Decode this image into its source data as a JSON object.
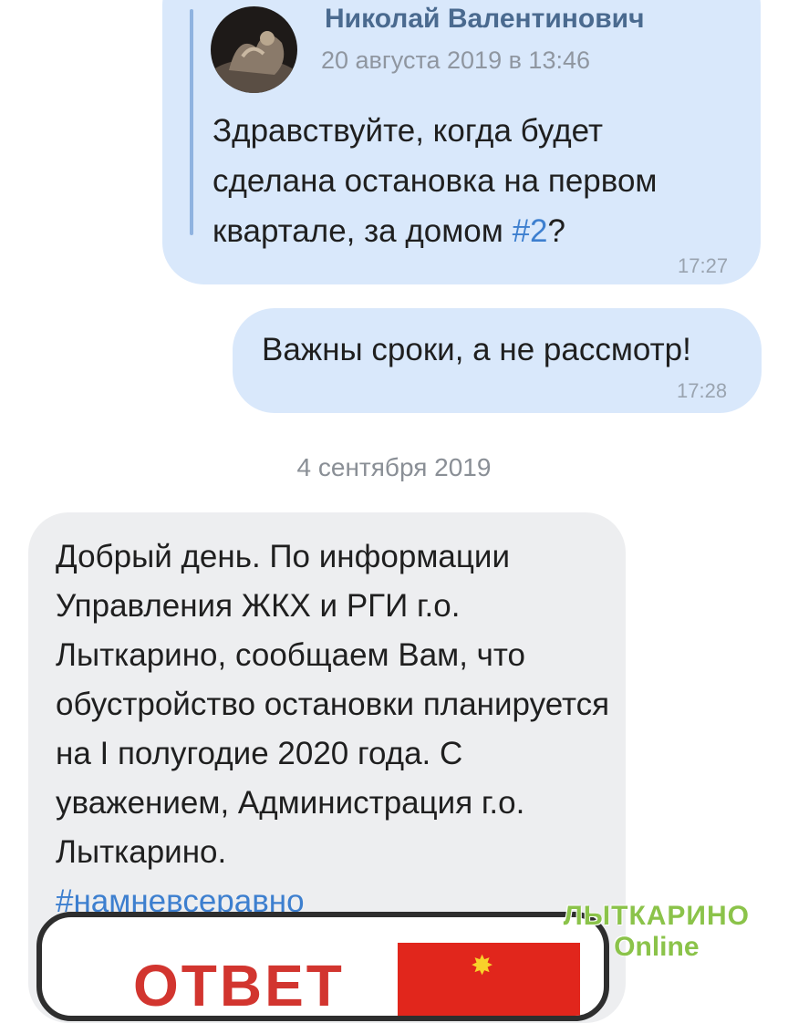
{
  "forwarded": {
    "author": "Николай Валентинович",
    "date": "20 августа 2019 в 13:46",
    "text_before": "Здравствуйте, когда будет сделана остановка на первом квартале, за домом ",
    "hashtag": "#2",
    "text_after": "?",
    "time": "17:27"
  },
  "reply": {
    "text": "Важны сроки, а не рассмотр!",
    "time": "17:28"
  },
  "date_separator": "4 сентября 2019",
  "incoming": {
    "text": "Добрый день. По информации Управления ЖКХ и РГИ г.о. Лыткарино, сообщаем Вам, что обустройство остановки планируется на I полугодие 2020 года. С уважением, Администрация г.о. Лыткарино.",
    "hashtag": "#намневсеравно"
  },
  "attachment": {
    "text": "ОТВЕТ"
  },
  "watermark": {
    "line1": "ЛЫТКАРИНО",
    "line2": "Online"
  },
  "colors": {
    "outgoing_bubble": "#d9e8fb",
    "incoming_bubble": "#edeef0",
    "link": "#3d7fcf",
    "watermark": "#8bc34a"
  }
}
